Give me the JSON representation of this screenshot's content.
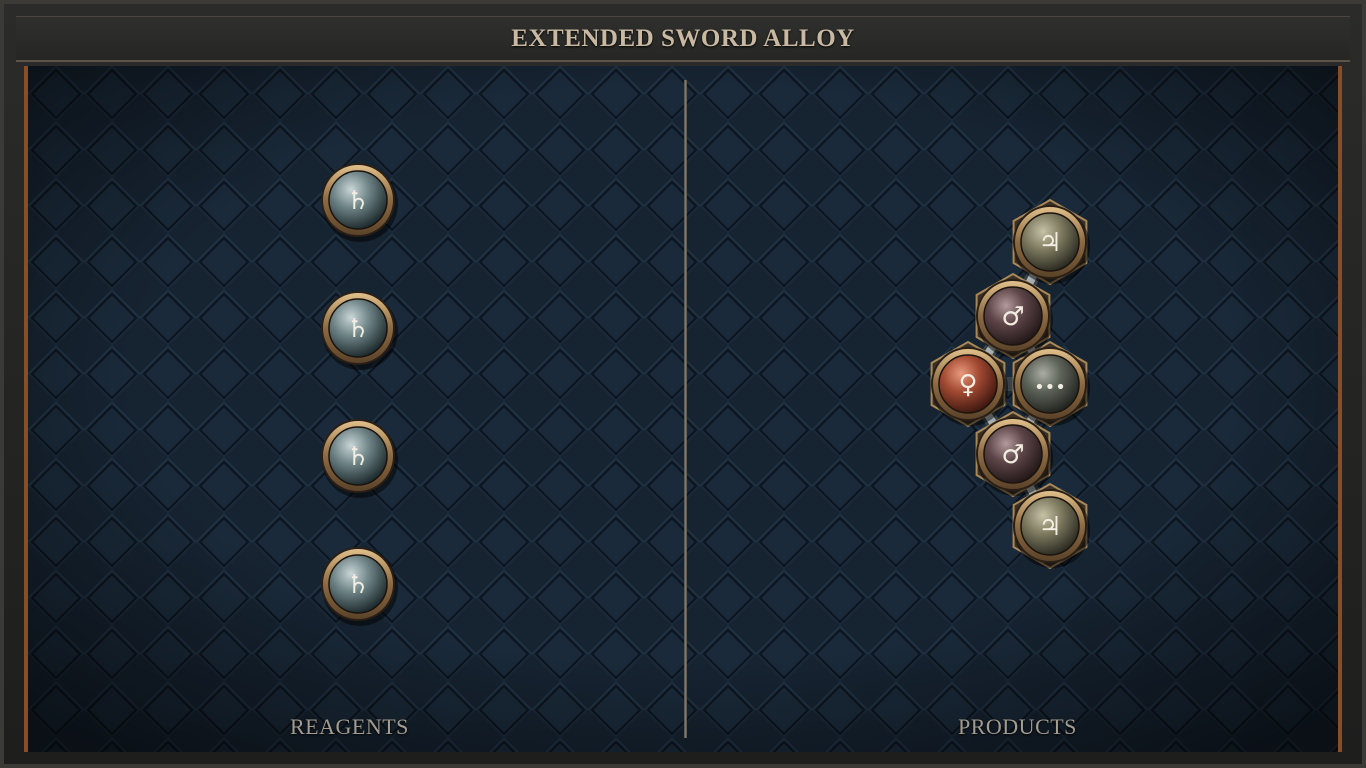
{
  "title": "EXTENDED SWORD ALLOY",
  "panels": {
    "reagents_label": "REAGENTS",
    "products_label": "PRODUCTS"
  },
  "reagents": [
    {
      "element": "lead",
      "symbol": "♄"
    },
    {
      "element": "lead",
      "symbol": "♄"
    },
    {
      "element": "lead",
      "symbol": "♄"
    },
    {
      "element": "lead",
      "symbol": "♄"
    }
  ],
  "product_atoms": [
    {
      "element": "tin",
      "symbol": "♃"
    },
    {
      "element": "iron",
      "symbol": "♂"
    },
    {
      "element": "copper",
      "symbol": "♀"
    },
    {
      "element": "salt-vacancy",
      "symbol": "•••"
    },
    {
      "element": "iron",
      "symbol": "♂"
    },
    {
      "element": "tin",
      "symbol": "♃"
    }
  ],
  "colors": {
    "lead": "#9fb0b3",
    "tin": "#8d8a6e",
    "iron": "#6f5558",
    "copper": "#b2543c",
    "vacancy": "#6a6e66",
    "bezel": "#b89468",
    "frame_accent": "#8a4e26"
  }
}
